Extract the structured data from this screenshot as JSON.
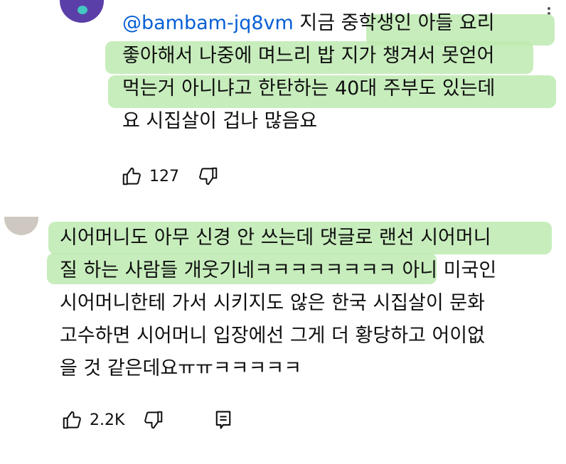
{
  "comments": [
    {
      "mention": "@bambam-jq8vm",
      "lines": [
        " 지금 중학생인 아들 요리",
        "좋아해서 나중에 며느리 밥 지가 챙겨서 못얻어",
        "먹는거 아니냐고 한탄하는 40대 주부도 있는데",
        "요 시집살이 겁나 많음요"
      ],
      "likes": "127"
    },
    {
      "lines": [
        "시어머니도 아무 신경 안 쓰는데 댓글로 랜선 시어머니",
        "질 하는 사람들 개웃기네ㅋㅋㅋㅋㅋㅋㅋㅋ 아니 미국인",
        "시어머니한테 가서 시키지도 않은 한국 시집살이 문화",
        "고수하면 시어머니 입장에선 그게 더 황당하고 어이없",
        "을 것 같은데요ㅠㅠㅋㅋㅋㅋㅋ"
      ],
      "likes": "2.2K"
    }
  ],
  "colors": {
    "highlight": "#bdeab0",
    "mention": "#065fd4"
  },
  "icons": [
    "like-icon",
    "dislike-icon",
    "reply-icon",
    "more-icon"
  ]
}
